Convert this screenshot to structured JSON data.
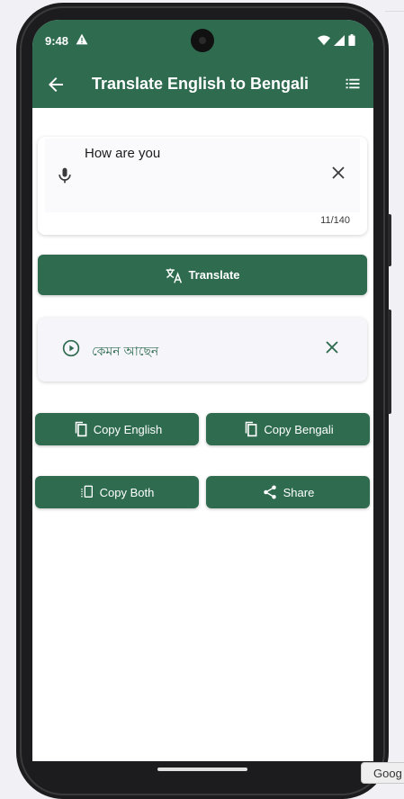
{
  "status_bar": {
    "time": "9:48"
  },
  "app_bar": {
    "title": "Translate English to Bengali"
  },
  "input": {
    "text": "How are you",
    "counter": "11/140"
  },
  "buttons": {
    "translate": "Translate",
    "copy_english": "Copy English",
    "copy_bengali": "Copy Bengali",
    "copy_both": "Copy Both",
    "share": "Share"
  },
  "result": {
    "text": "কেমন আছেন"
  },
  "overlay": {
    "chip_text": "Goog"
  },
  "colors": {
    "primary": "#2e6b4f",
    "result_bg": "#f6f5fa",
    "surface": "#ffffff"
  }
}
